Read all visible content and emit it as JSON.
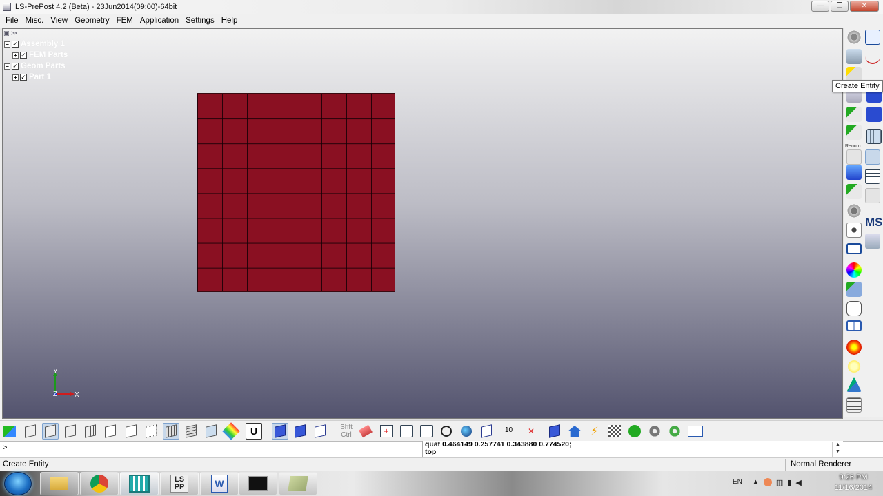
{
  "window": {
    "title": "LS-PrePost 4.2 (Beta) - 23Jun2014(09:00)-64bit",
    "controls": {
      "minimize": "—",
      "maximize": "❐",
      "close": "✕"
    }
  },
  "menu": [
    "File",
    "Misc.",
    "View",
    "Geometry",
    "FEM",
    "Application",
    "Settings",
    "Help"
  ],
  "tree": {
    "items": [
      {
        "label": "Assembly 1",
        "level": 0
      },
      {
        "label": "FEM Parts",
        "level": 1
      },
      {
        "label": "Geom Parts",
        "level": 0
      },
      {
        "label": "Part 1",
        "level": 1
      }
    ]
  },
  "mesh": {
    "rows": 8,
    "cols": 8,
    "color": "#8a1022"
  },
  "triad": {
    "y_label": "Y",
    "z_label": "Z",
    "x_label": "X"
  },
  "right_toolbar": {
    "tooltip": "Create Entity",
    "renum_label": "Renum",
    "ms_label": "MS"
  },
  "bottom_toolbar": {
    "shft_label": "Shft",
    "ctrl_label": "Ctrl",
    "number_label": "10"
  },
  "command": {
    "prompt": ">",
    "output_line1": "quat 0.464149 0.257741 0.343880 0.774520;",
    "output_line2": "top"
  },
  "status": {
    "left": "Create Entity",
    "right": "Normal Renderer"
  },
  "taskbar": {
    "apps": [
      "explorer",
      "chrome",
      "ls-dyna-manager",
      "lspp",
      "word",
      "cmd",
      "notepad"
    ],
    "lspp_label": "LS PP",
    "lang": "EN",
    "time": "9:26 PM",
    "date": "11/16/2014"
  },
  "colors": {
    "mesh": "#8a1022",
    "viewport_top": "#f2f2f2",
    "viewport_bottom": "#53536e",
    "accent_blue": "#3858d8"
  }
}
